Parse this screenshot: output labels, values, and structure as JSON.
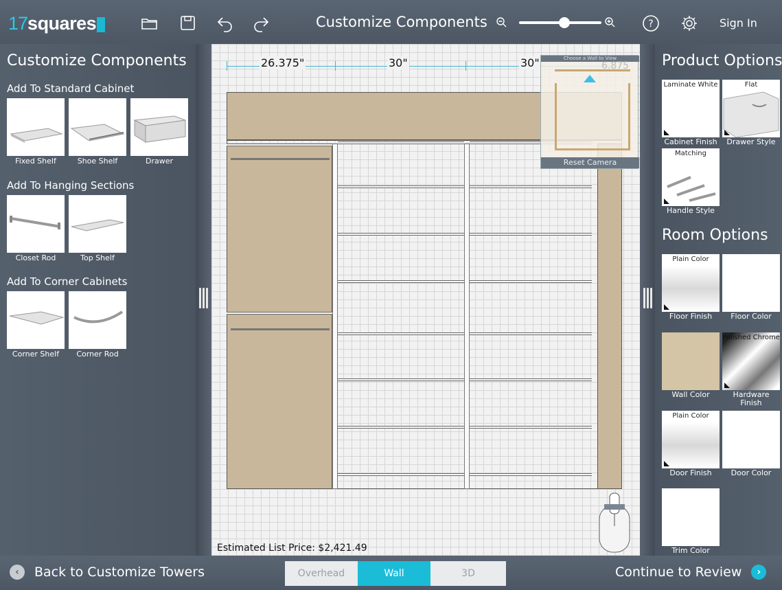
{
  "app": {
    "logo_num": "17",
    "logo_word": "squares",
    "title": "Customize Components",
    "signin": "Sign In",
    "zoom_level": 0.6
  },
  "left": {
    "title": "Customize Components",
    "sections": [
      {
        "title": "Add To Standard Cabinet",
        "items": [
          "Fixed Shelf",
          "Shoe Shelf",
          "Drawer"
        ]
      },
      {
        "title": "Add To Hanging Sections",
        "items": [
          "Closet Rod",
          "Top Shelf"
        ]
      },
      {
        "title": "Add To Corner Cabinets",
        "items": [
          "Corner Shelf",
          "Corner Rod"
        ]
      }
    ]
  },
  "canvas": {
    "dims": [
      "26.375\"",
      "30\"",
      "30\"",
      "6.875"
    ],
    "price": "Estimated List Price: $2,421.49",
    "minimap_head": "Choose a Wall to View",
    "minimap_reset": "Reset Camera"
  },
  "right": {
    "product_title": "Product Options",
    "room_title": "Room Options",
    "product_items": [
      {
        "label": "Cabinet Finish",
        "caption": "Laminate White"
      },
      {
        "label": "Drawer Style",
        "caption": "Flat"
      },
      {
        "label": "Handle Style",
        "caption": "Matching"
      }
    ],
    "room_items": [
      {
        "label": "Floor Finish",
        "caption": "Plain Color"
      },
      {
        "label": "Floor Color",
        "caption": ""
      },
      {
        "label": "Wall Color",
        "caption": ""
      },
      {
        "label": "Hardware Finish",
        "caption": "Polished Chrome"
      },
      {
        "label": "Door Finish",
        "caption": "Plain Color"
      },
      {
        "label": "Door Color",
        "caption": ""
      },
      {
        "label": "Trim Color",
        "caption": ""
      }
    ]
  },
  "bottom": {
    "back": "Back to Customize Towers",
    "forward": "Continue to Review",
    "views": [
      "Overhead",
      "Wall",
      "3D"
    ],
    "active_view": "Wall"
  },
  "colors": {
    "accent": "#1bbcd8",
    "wall": "#c9b79b",
    "panel": "#4f5966"
  }
}
